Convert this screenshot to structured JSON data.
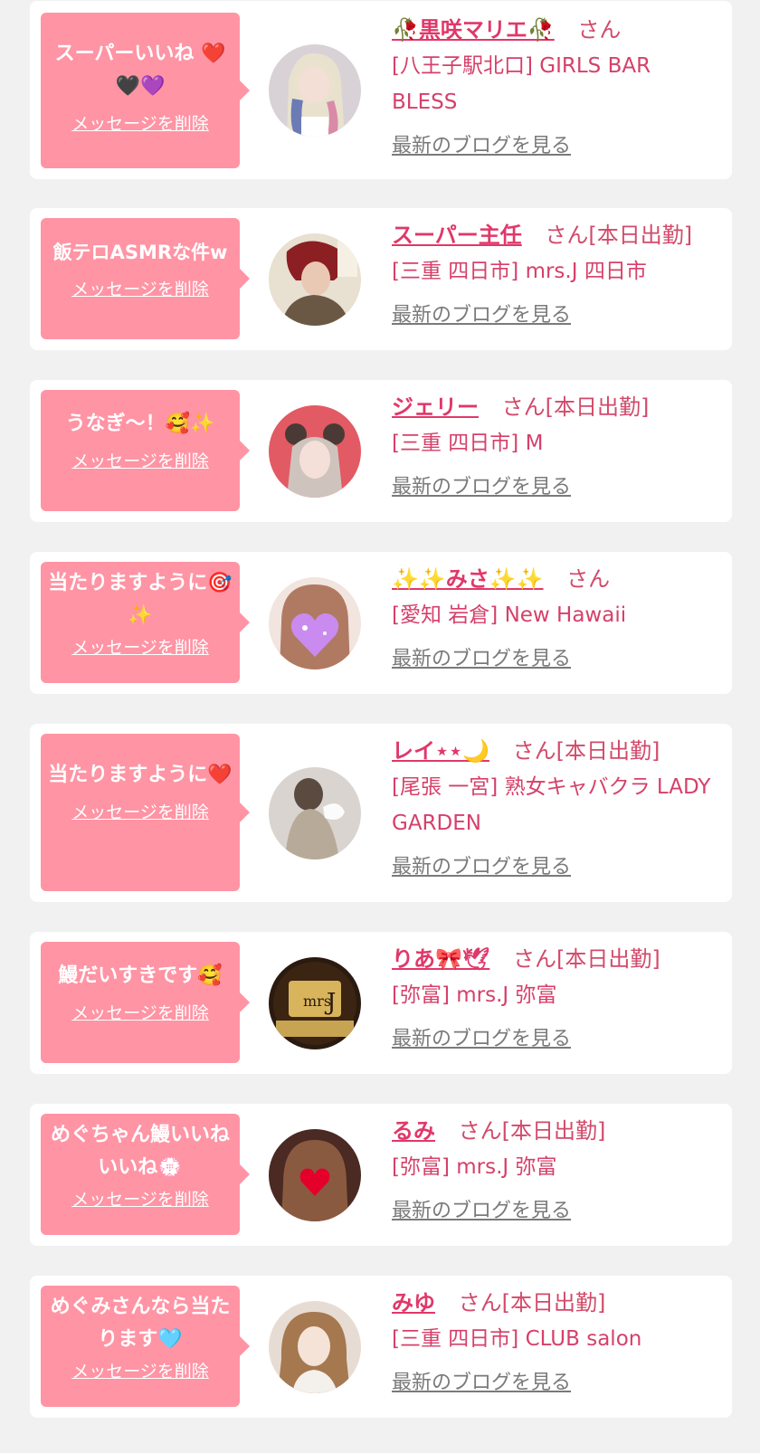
{
  "common": {
    "delete_label": "メッセージを削除",
    "blog_label": "最新のブログを見る",
    "san": "さん"
  },
  "items": [
    {
      "message": "スーパーいいね ❤️🖤💜",
      "name": "🥀黒咲マリエ🥀",
      "status": "",
      "shop": "[八王子駅北口] GIRLS BAR BLESS"
    },
    {
      "message": "飯テロASMRな件w",
      "name": "スーパー主任",
      "status": "[本日出勤]",
      "shop": "[三重 四日市] mrs.J 四日市"
    },
    {
      "message": "うなぎ〜！🥰✨",
      "name": "ジェリー",
      "status": "[本日出勤]",
      "shop": "[三重 四日市] M"
    },
    {
      "message": "当たりますように🎯✨",
      "name": "✨✨みさ✨✨",
      "status": "",
      "shop": "[愛知 岩倉] New Hawaii"
    },
    {
      "message": "当たりますように❤️",
      "name": "レイ⋆⋆🌙",
      "status": "[本日出勤]",
      "shop": "[尾張 一宮] 熟女キャバクラ LADY GARDEN"
    },
    {
      "message": "鰻だいすきです🥰",
      "name": "りあ🎀🕊",
      "status": "[本日出勤]",
      "shop": "[弥富] mrs.J 弥富"
    },
    {
      "message": "めぐちゃん鰻いいねいいね💮",
      "name": "るみ",
      "status": "[本日出勤]",
      "shop": "[弥富] mrs.J 弥富"
    },
    {
      "message": "めぐみさんなら当たります🩵",
      "name": "みゆ",
      "status": "[本日出勤]",
      "shop": "[三重 四日市] CLUB salon"
    }
  ],
  "colors": {
    "page_bg": "#f1f1f1",
    "bubble_bg": "#ff94a4",
    "name_color": "#e03869",
    "shop_color": "#d6406a",
    "blog_link_color": "#7a7a7a"
  },
  "avatars": [
    "avatar-blonde-woman",
    "avatar-red-hair-man",
    "avatar-twin-bun-girl",
    "avatar-heart-face",
    "avatar-back-view-lace",
    "avatar-mrsj-logo",
    "avatar-heart-face-2",
    "avatar-long-hair-girl"
  ]
}
